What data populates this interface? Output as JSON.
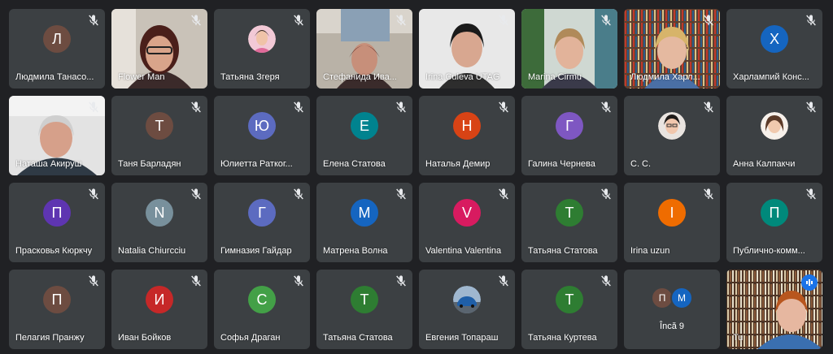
{
  "tiles": [
    {
      "name": "Людмила Танасо...",
      "initial": "Л",
      "color": "#6d4c41",
      "kind": "avatar"
    },
    {
      "name": "Flower Man",
      "kind": "video",
      "scene": "woman-dark-hair"
    },
    {
      "name": "Татьяна Згеря",
      "kind": "photo",
      "scene": "girl-pink"
    },
    {
      "name": "Стефанида Ива...",
      "kind": "video",
      "scene": "woman-office"
    },
    {
      "name": "Irina Culeva UTAG",
      "kind": "video",
      "scene": "woman-white"
    },
    {
      "name": "Marina Cirmu",
      "kind": "video",
      "scene": "woman-plants"
    },
    {
      "name": "Людмила Харл...",
      "kind": "video",
      "scene": "woman-books"
    },
    {
      "name": "Харлампий Конс...",
      "initial": "Х",
      "color": "#1565c0",
      "kind": "avatar"
    },
    {
      "name": "Наташа Акируш",
      "kind": "video",
      "scene": "old-woman"
    },
    {
      "name": "Таня Барладян",
      "initial": "Т",
      "color": "#6d4c41",
      "kind": "avatar"
    },
    {
      "name": "Юлиетта Раткoг...",
      "initial": "Ю",
      "color": "#5c6bc0",
      "kind": "avatar"
    },
    {
      "name": "Елена Статова",
      "initial": "Е",
      "color": "#00838f",
      "kind": "avatar"
    },
    {
      "name": "Наталья Демир",
      "initial": "Н",
      "color": "#d84315",
      "kind": "avatar"
    },
    {
      "name": "Галина Чернева",
      "initial": "Г",
      "color": "#7e57c2",
      "kind": "avatar"
    },
    {
      "name": "С. С.",
      "kind": "photo",
      "scene": "girl-glasses"
    },
    {
      "name": "Анна Калпакчи",
      "kind": "photo",
      "scene": "girl-brown"
    },
    {
      "name": "Прасковья Кюркчу",
      "initial": "П",
      "color": "#5e35b1",
      "kind": "avatar"
    },
    {
      "name": "Natalia Chiurcciu",
      "initial": "N",
      "color": "#78909c",
      "kind": "avatar"
    },
    {
      "name": "Гимназия Гайдар",
      "initial": "Г",
      "color": "#5c6bc0",
      "kind": "avatar"
    },
    {
      "name": "Матрена Волна",
      "initial": "М",
      "color": "#1565c0",
      "kind": "avatar"
    },
    {
      "name": "Valentina Valentina",
      "initial": "V",
      "color": "#d81b60",
      "kind": "avatar"
    },
    {
      "name": "Татьяна Статова",
      "initial": "Т",
      "color": "#2e7d32",
      "kind": "avatar"
    },
    {
      "name": "Irina uzun",
      "initial": "I",
      "color": "#ef6c00",
      "kind": "avatar"
    },
    {
      "name": "Публично-комм...",
      "initial": "П",
      "color": "#00897b",
      "kind": "avatar"
    },
    {
      "name": "Пелагия Пранжу",
      "initial": "П",
      "color": "#6d4c41",
      "kind": "avatar"
    },
    {
      "name": "Иван Бойков",
      "initial": "И",
      "color": "#c62828",
      "kind": "avatar"
    },
    {
      "name": "Софья Драган",
      "initial": "С",
      "color": "#43a047",
      "kind": "avatar"
    },
    {
      "name": "Татьяна Статова",
      "initial": "Т",
      "color": "#2e7d32",
      "kind": "avatar"
    },
    {
      "name": "Евгения Топараш",
      "kind": "photo",
      "scene": "car"
    },
    {
      "name": "Татьяна Куртева",
      "initial": "Т",
      "color": "#2e7d32",
      "kind": "avatar"
    },
    {
      "kind": "more",
      "label": "Încă 9",
      "mini": [
        {
          "initial": "П",
          "color": "#6d4c41"
        },
        {
          "initial": "M",
          "color": "#1565c0"
        }
      ]
    },
    {
      "name": "Tu",
      "kind": "self",
      "scene": "self-books"
    }
  ]
}
